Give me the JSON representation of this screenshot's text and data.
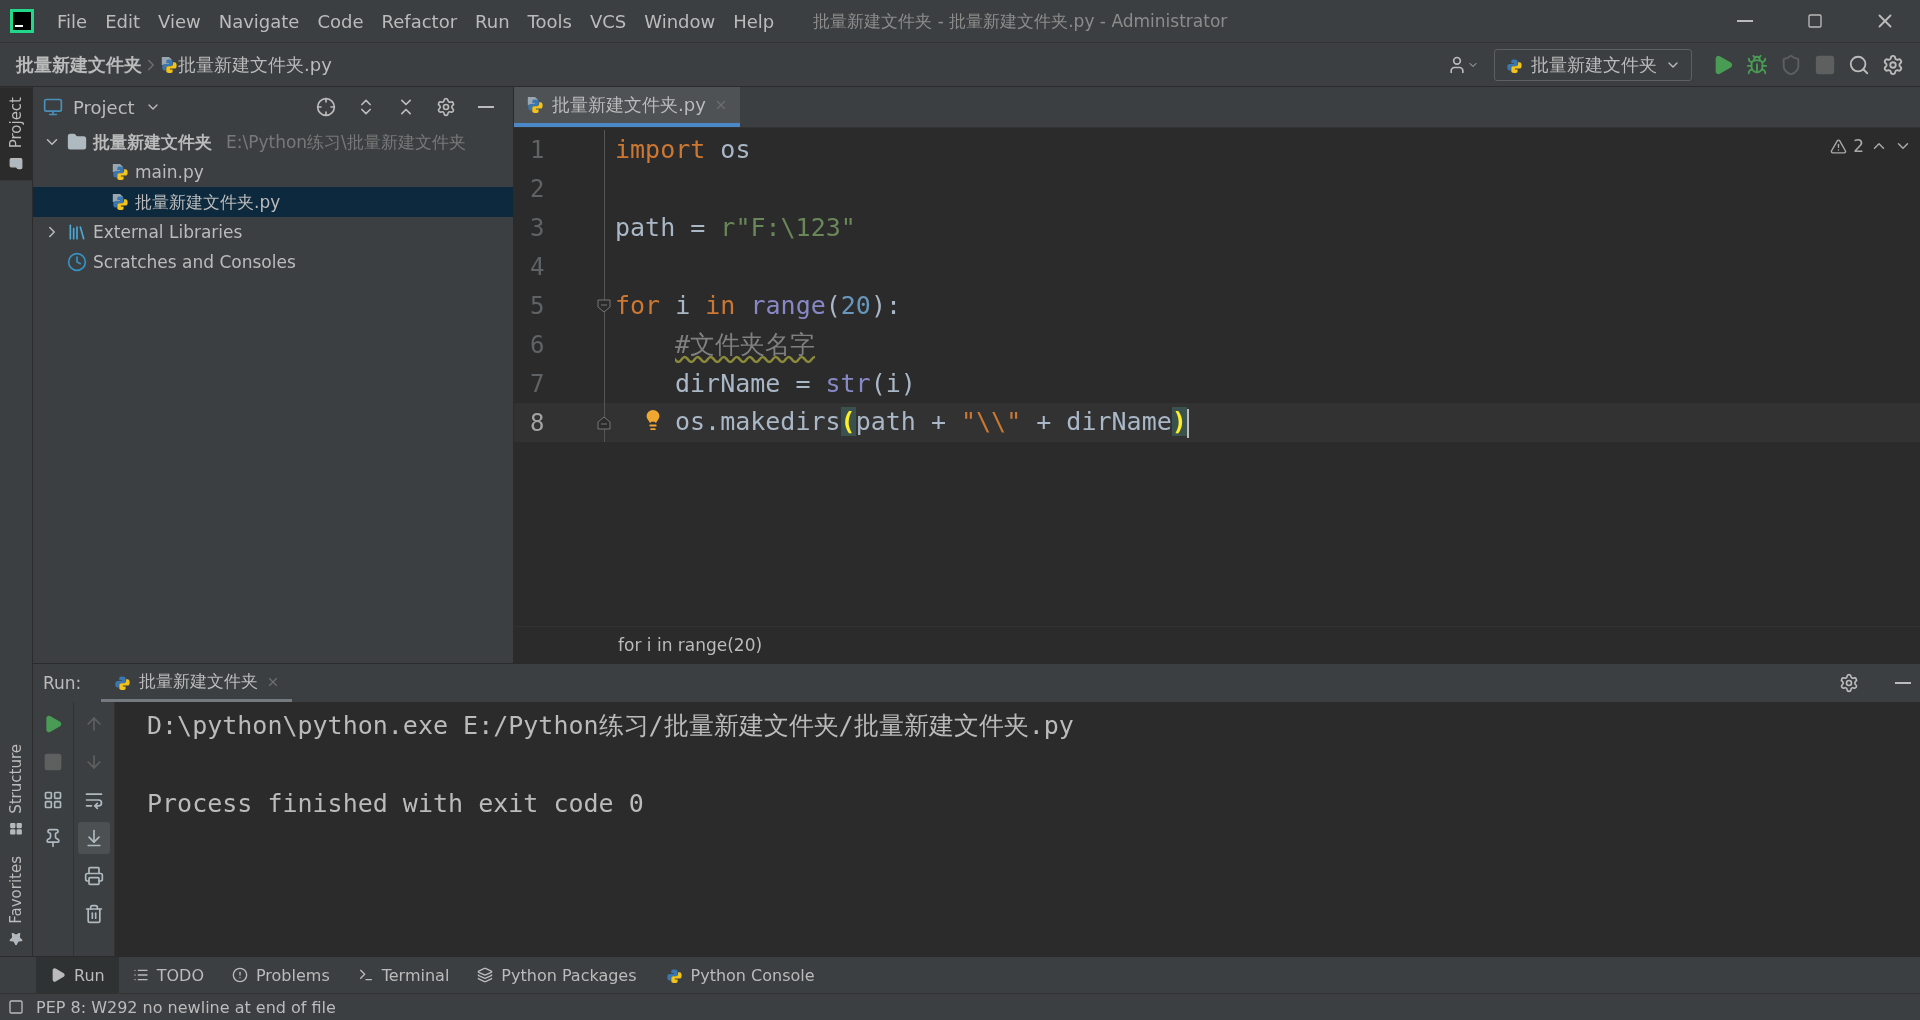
{
  "window": {
    "title": "批量新建文件夹 - 批量新建文件夹.py - Administrator"
  },
  "menu": [
    {
      "label": "File"
    },
    {
      "label": "Edit"
    },
    {
      "label": "View"
    },
    {
      "label": "Navigate"
    },
    {
      "label": "Code"
    },
    {
      "label": "Refactor"
    },
    {
      "label": "Run"
    },
    {
      "label": "Tools"
    },
    {
      "label": "VCS"
    },
    {
      "label": "Window"
    },
    {
      "label": "Help"
    }
  ],
  "breadcrumbs": [
    {
      "label": "批量新建文件夹",
      "kind": "folder"
    },
    {
      "label": "批量新建文件夹.py",
      "kind": "file"
    }
  ],
  "run_config": {
    "label": "批量新建文件夹"
  },
  "toolbar_actions": [
    {
      "kind": "run",
      "disabled": false
    },
    {
      "kind": "debug",
      "disabled": false
    },
    {
      "kind": "coverage",
      "disabled": true
    },
    {
      "kind": "stop",
      "disabled": true
    },
    {
      "kind": "search",
      "disabled": false
    },
    {
      "kind": "settings",
      "disabled": false
    }
  ],
  "side_stripe": [
    {
      "label": "Project",
      "selected": true,
      "kind": "folder"
    },
    {
      "label": "Structure",
      "selected": false,
      "kind": "structure"
    },
    {
      "label": "Favorites",
      "selected": false,
      "kind": "star"
    }
  ],
  "project": {
    "title": "Project",
    "tree": [
      {
        "label": "批量新建文件夹",
        "path": "E:\\Python练习\\批量新建文件夹",
        "kind": "folder",
        "expanded": true,
        "selected": false,
        "children": [
          {
            "label": "main.py",
            "kind": "python",
            "selected": false
          },
          {
            "label": "批量新建文件夹.py",
            "kind": "python",
            "selected": true
          }
        ]
      },
      {
        "label": "External Libraries",
        "kind": "library",
        "expanded": false,
        "selected": false
      },
      {
        "label": "Scratches and Consoles",
        "kind": "scratch",
        "selected": false
      }
    ]
  },
  "editor": {
    "tabs": [
      {
        "label": "批量新建文件夹.py",
        "selected": true
      }
    ],
    "warnings": "2",
    "lines": [
      {
        "number": "1",
        "current": false,
        "indented": false,
        "tokens": [
          {
            "kind": "keyword",
            "text": "import"
          },
          {
            "kind": "plain",
            "text": " os"
          }
        ]
      },
      {
        "number": "2",
        "current": false
      },
      {
        "number": "3",
        "current": false,
        "indented": false,
        "tokens": [
          {
            "kind": "plain",
            "text": "path = "
          },
          {
            "kind": "string",
            "text": "r\"F:\\123\""
          }
        ]
      },
      {
        "number": "4",
        "current": false
      },
      {
        "number": "5",
        "current": false,
        "fold_start": true,
        "indented": false,
        "tokens": [
          {
            "kind": "keyword",
            "text": "for"
          },
          {
            "kind": "plain",
            "text": " i "
          },
          {
            "kind": "keyword",
            "text": "in"
          },
          {
            "kind": "builtin",
            "text": " range"
          },
          {
            "kind": "plain",
            "text": "("
          },
          {
            "kind": "number",
            "text": "20"
          },
          {
            "kind": "plain",
            "text": "):"
          }
        ]
      },
      {
        "number": "6",
        "current": false,
        "indented": true,
        "tokens": [
          {
            "kind": "comment",
            "text": "#文件夹名字"
          }
        ]
      },
      {
        "number": "7",
        "current": false,
        "indented": true,
        "tokens": [
          {
            "kind": "plain",
            "text": "dirName = "
          },
          {
            "kind": "builtin",
            "text": "str"
          },
          {
            "kind": "plain",
            "text": "(i)"
          }
        ]
      },
      {
        "number": "8",
        "current": true,
        "indented": true,
        "fold_end": true,
        "bulb": true,
        "tokens": [
          {
            "kind": "plain",
            "text": "os.makedirs"
          },
          {
            "kind": "match",
            "text": "("
          },
          {
            "kind": "plain",
            "text": "path + "
          },
          {
            "kind": "string-escape",
            "text": "\"\\\\\""
          },
          {
            "kind": "plain",
            "text": " + dirName"
          },
          {
            "kind": "match",
            "text": ")"
          }
        ]
      }
    ],
    "breadcrumb": "for i in range(20)"
  },
  "run_panel": {
    "label": "Run:",
    "tabs": [
      {
        "label": "批量新建文件夹",
        "selected": true
      }
    ],
    "tools_left": [
      {
        "kind": "run",
        "disabled": false
      },
      {
        "kind": "stop",
        "disabled": true
      },
      {
        "kind": "layout",
        "disabled": false
      },
      {
        "kind": "pin",
        "disabled": false
      }
    ],
    "tools_right": [
      {
        "kind": "up",
        "disabled": true,
        "on": false
      },
      {
        "kind": "down",
        "disabled": true,
        "on": false
      },
      {
        "kind": "wrap",
        "disabled": false,
        "on": false
      },
      {
        "kind": "scroll-end",
        "disabled": false,
        "on": true
      },
      {
        "kind": "print",
        "disabled": false,
        "on": false
      },
      {
        "kind": "trash",
        "disabled": false,
        "on": false
      }
    ],
    "output": [
      "D:\\python\\python.exe E:/Python练习/批量新建文件夹/批量新建文件夹.py",
      "Process finished with exit code 0"
    ]
  },
  "bottom_tabs": [
    {
      "label": "Run",
      "kind": "run",
      "selected": true
    },
    {
      "label": "TODO",
      "kind": "list",
      "selected": false
    },
    {
      "label": "Problems",
      "kind": "problems",
      "selected": false
    },
    {
      "label": "Terminal",
      "kind": "terminal",
      "selected": false
    },
    {
      "label": "Python Packages",
      "kind": "layers",
      "selected": false
    },
    {
      "label": "Python Console",
      "kind": "python",
      "selected": false
    }
  ],
  "status_bar": {
    "message": "PEP 8: W292 no newline at end of file"
  }
}
